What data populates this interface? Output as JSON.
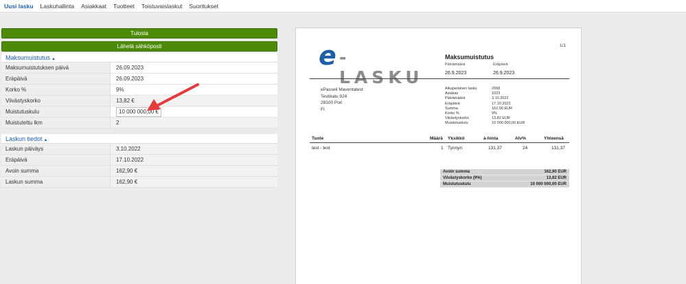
{
  "nav": {
    "items": [
      {
        "label": "Uusi lasku",
        "active": true
      },
      {
        "label": "Laskuhallinta"
      },
      {
        "label": "Asiakkaat"
      },
      {
        "label": "Tuotteet"
      },
      {
        "label": "Toistuvaislaskut"
      },
      {
        "label": "Suoritukset"
      }
    ]
  },
  "actions": {
    "print_label": "Tulosta",
    "email_label": "Lähetä sähköposti"
  },
  "reminder": {
    "title": "Maksumuistutus",
    "rows": [
      {
        "label": "Maksumuistutuksen päivä",
        "value": "26.09.2023"
      },
      {
        "label": "Eräpäivä",
        "value": "26.09.2023"
      },
      {
        "label": "Korko %",
        "value": "9%"
      },
      {
        "label": "Viivästyskorko",
        "value": "13,82 €"
      },
      {
        "label": "Muistutuskulu",
        "value": "10 000 000,00 €"
      },
      {
        "label": "Muistutettu lkm",
        "value": "2"
      }
    ]
  },
  "invoice_info": {
    "title": "Laskun tiedot",
    "rows": [
      {
        "label": "Laskun päiväys",
        "value": "3.10.2022"
      },
      {
        "label": "Eräpäivä",
        "value": "17.10.2022"
      },
      {
        "label": "Avoin summa",
        "value": "162,90 €"
      },
      {
        "label": "Laskun summa",
        "value": "162,90 €"
      }
    ]
  },
  "preview": {
    "page": "1/1",
    "logo_e": "e",
    "logo_rest": "-LASKU",
    "title": "Maksumuistutus",
    "date_label": "Päivämäärä",
    "due_label": "Eräpäivä",
    "date_value": "26.9.2023",
    "due_value": "26.9.2023",
    "address": [
      "ePasseli Maventatest",
      "Testikatu 924",
      "28100 Pori",
      "FI"
    ],
    "meta": [
      {
        "label": "Alkuperäinen lasku",
        "value": "2068"
      },
      {
        "label": "Asiakas",
        "value": "1023"
      },
      {
        "label": "Päivämäärä",
        "value": "3.10.2022"
      },
      {
        "label": "Eräpäivä",
        "value": "17.10.2022"
      },
      {
        "label": "Summa",
        "value": "162,90 EUR"
      },
      {
        "label": "Korko %",
        "value": "9%"
      },
      {
        "label": "Viivästyskorko",
        "value": "13,82 EUR"
      },
      {
        "label": "Muistutuskulu",
        "value": "10 000 000,00 EUR"
      }
    ],
    "columns": {
      "product": "Tuote",
      "qty": "Määrä",
      "unit": "Yksikkö",
      "price": "à-hinta",
      "vat": "Alv%",
      "total": "Yhteensä"
    },
    "line": {
      "product": "test - test",
      "qty": "1",
      "unit": "Tynnyri",
      "price": "131,37",
      "vat": "24",
      "total": "131,37"
    },
    "totals": [
      {
        "label": "Avoin summa",
        "value": "162,90 EUR"
      },
      {
        "label": "Viivästyskorko (9%)",
        "value": "13,82 EUR"
      },
      {
        "label": "Muistutuskulu",
        "value": "10 000 000,00 EUR"
      }
    ]
  },
  "colors": {
    "brand_blue": "#1f5fa8",
    "button_green": "#4d8a07",
    "arrow_red": "#e23b3b"
  }
}
